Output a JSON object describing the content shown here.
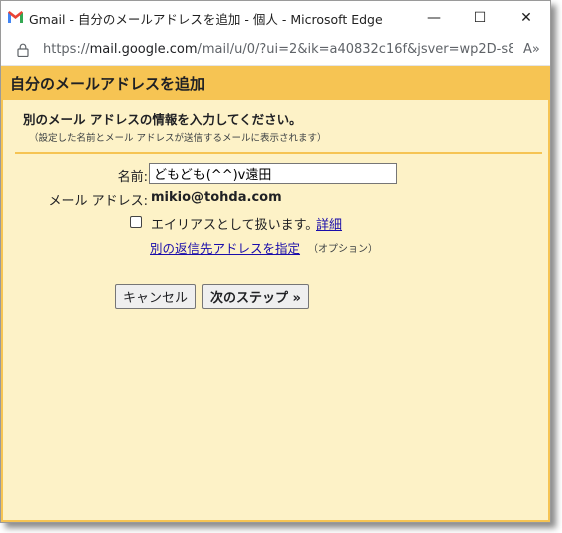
{
  "window": {
    "title": "Gmail - 自分のメールアドレスを追加 - 個人 - Microsoft Edge",
    "controls": {
      "minimize": "—",
      "maximize": "☐",
      "close": "✕"
    }
  },
  "addressbar": {
    "url_scheme": "https://",
    "url_host": "mail.google.com",
    "url_path": "/mail/u/0/?ui=2&ik=a40832c16f&jsver=wp2D-s8...",
    "read_aloud_icon": "A»"
  },
  "dialog": {
    "title": "自分のメールアドレスを追加",
    "intro_title": "別のメール アドレスの情報を入力してください。",
    "intro_sub": "（設定した名前とメール アドレスが送信するメールに表示されます）",
    "name_label": "名前:",
    "name_value": "どもども(^^)v遠田",
    "email_label": "メール アドレス:",
    "email_value": "mikio@tohda.com",
    "alias_label": "エイリアスとして扱います。",
    "alias_checked": false,
    "details_link": "詳細",
    "reply_to_link": "別の返信先アドレスを指定",
    "optional_note": "（オプション）",
    "cancel_button": "キャンセル",
    "next_button": "次のステップ »"
  },
  "colors": {
    "header": "#f6c453",
    "content_bg": "#fdf2c7",
    "link": "#1a0dab"
  }
}
